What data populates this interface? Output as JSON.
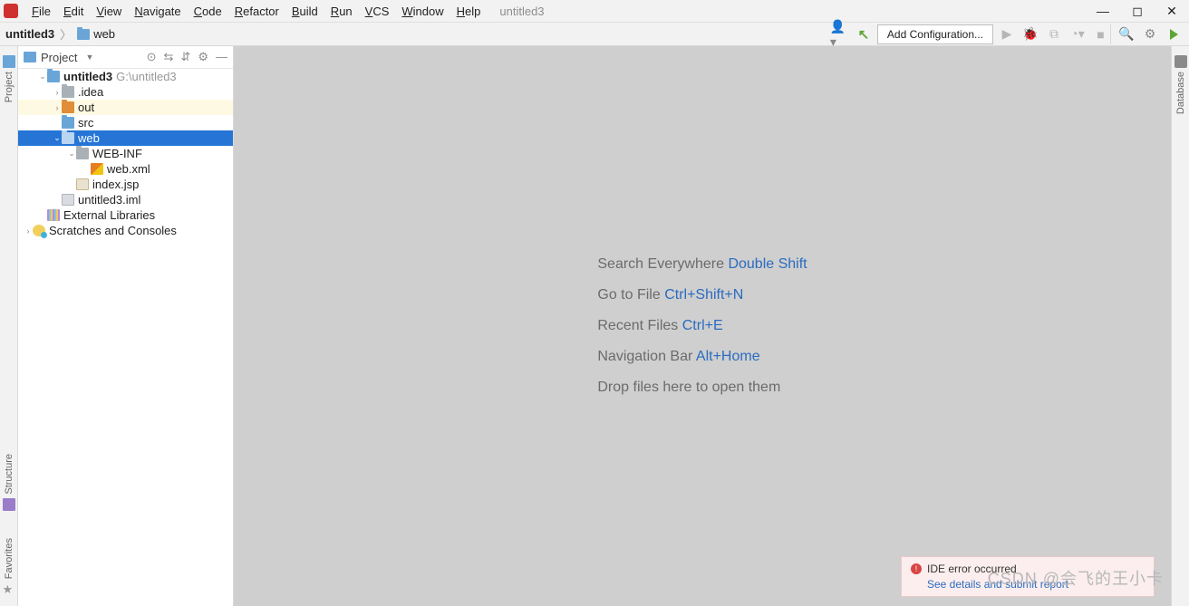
{
  "menu": {
    "items": [
      "File",
      "Edit",
      "View",
      "Navigate",
      "Code",
      "Refactor",
      "Build",
      "Run",
      "VCS",
      "Window",
      "Help"
    ],
    "doc_title": "untitled3"
  },
  "window_controls": {
    "min": "—",
    "max": "◻",
    "close": "✕"
  },
  "breadcrumb": {
    "project": "untitled3",
    "current": "web"
  },
  "toolbar": {
    "add_config_label": "Add Configuration..."
  },
  "project_panel": {
    "title": "Project",
    "tree": [
      {
        "depth": 0,
        "arrow": "v",
        "icon": "folder-blue",
        "label": "untitled3",
        "suffix": "G:\\untitled3",
        "hl": ""
      },
      {
        "depth": 1,
        "arrow": ">",
        "icon": "folder-grey",
        "label": ".idea",
        "hl": ""
      },
      {
        "depth": 1,
        "arrow": ">",
        "icon": "folder-orange",
        "label": "out",
        "hl": "out"
      },
      {
        "depth": 1,
        "arrow": "",
        "icon": "folder-blue",
        "label": "src",
        "hl": ""
      },
      {
        "depth": 1,
        "arrow": "v",
        "icon": "folder-blue",
        "label": "web",
        "hl": "sel"
      },
      {
        "depth": 2,
        "arrow": "v",
        "icon": "folder-grey",
        "label": "WEB-INF",
        "hl": ""
      },
      {
        "depth": 3,
        "arrow": "",
        "icon": "xml",
        "label": "web.xml",
        "hl": ""
      },
      {
        "depth": 2,
        "arrow": "",
        "icon": "jsp",
        "label": "index.jsp",
        "hl": ""
      },
      {
        "depth": 1,
        "arrow": "",
        "icon": "iml",
        "label": "untitled3.iml",
        "hl": ""
      },
      {
        "depth": 0,
        "arrow": "",
        "icon": "lib",
        "label": "External Libraries",
        "hl": "",
        "root": true
      },
      {
        "depth": 0,
        "arrow": ">",
        "icon": "scratch",
        "label": "Scratches and Consoles",
        "hl": "",
        "root": true
      }
    ]
  },
  "editor_hints": [
    {
      "text": "Search Everywhere ",
      "shortcut": "Double Shift"
    },
    {
      "text": "Go to File ",
      "shortcut": "Ctrl+Shift+N"
    },
    {
      "text": "Recent Files ",
      "shortcut": "Ctrl+E"
    },
    {
      "text": "Navigation Bar ",
      "shortcut": "Alt+Home"
    },
    {
      "text": "Drop files here to open them",
      "shortcut": ""
    }
  ],
  "right_rail": {
    "label": "Database"
  },
  "left_rail": {
    "top": "Project",
    "mid": "Structure",
    "bot": "Favorites"
  },
  "toast": {
    "title": "IDE error occurred",
    "link": "See details and submit report"
  },
  "watermark": "CSDN @会飞的王小卡"
}
